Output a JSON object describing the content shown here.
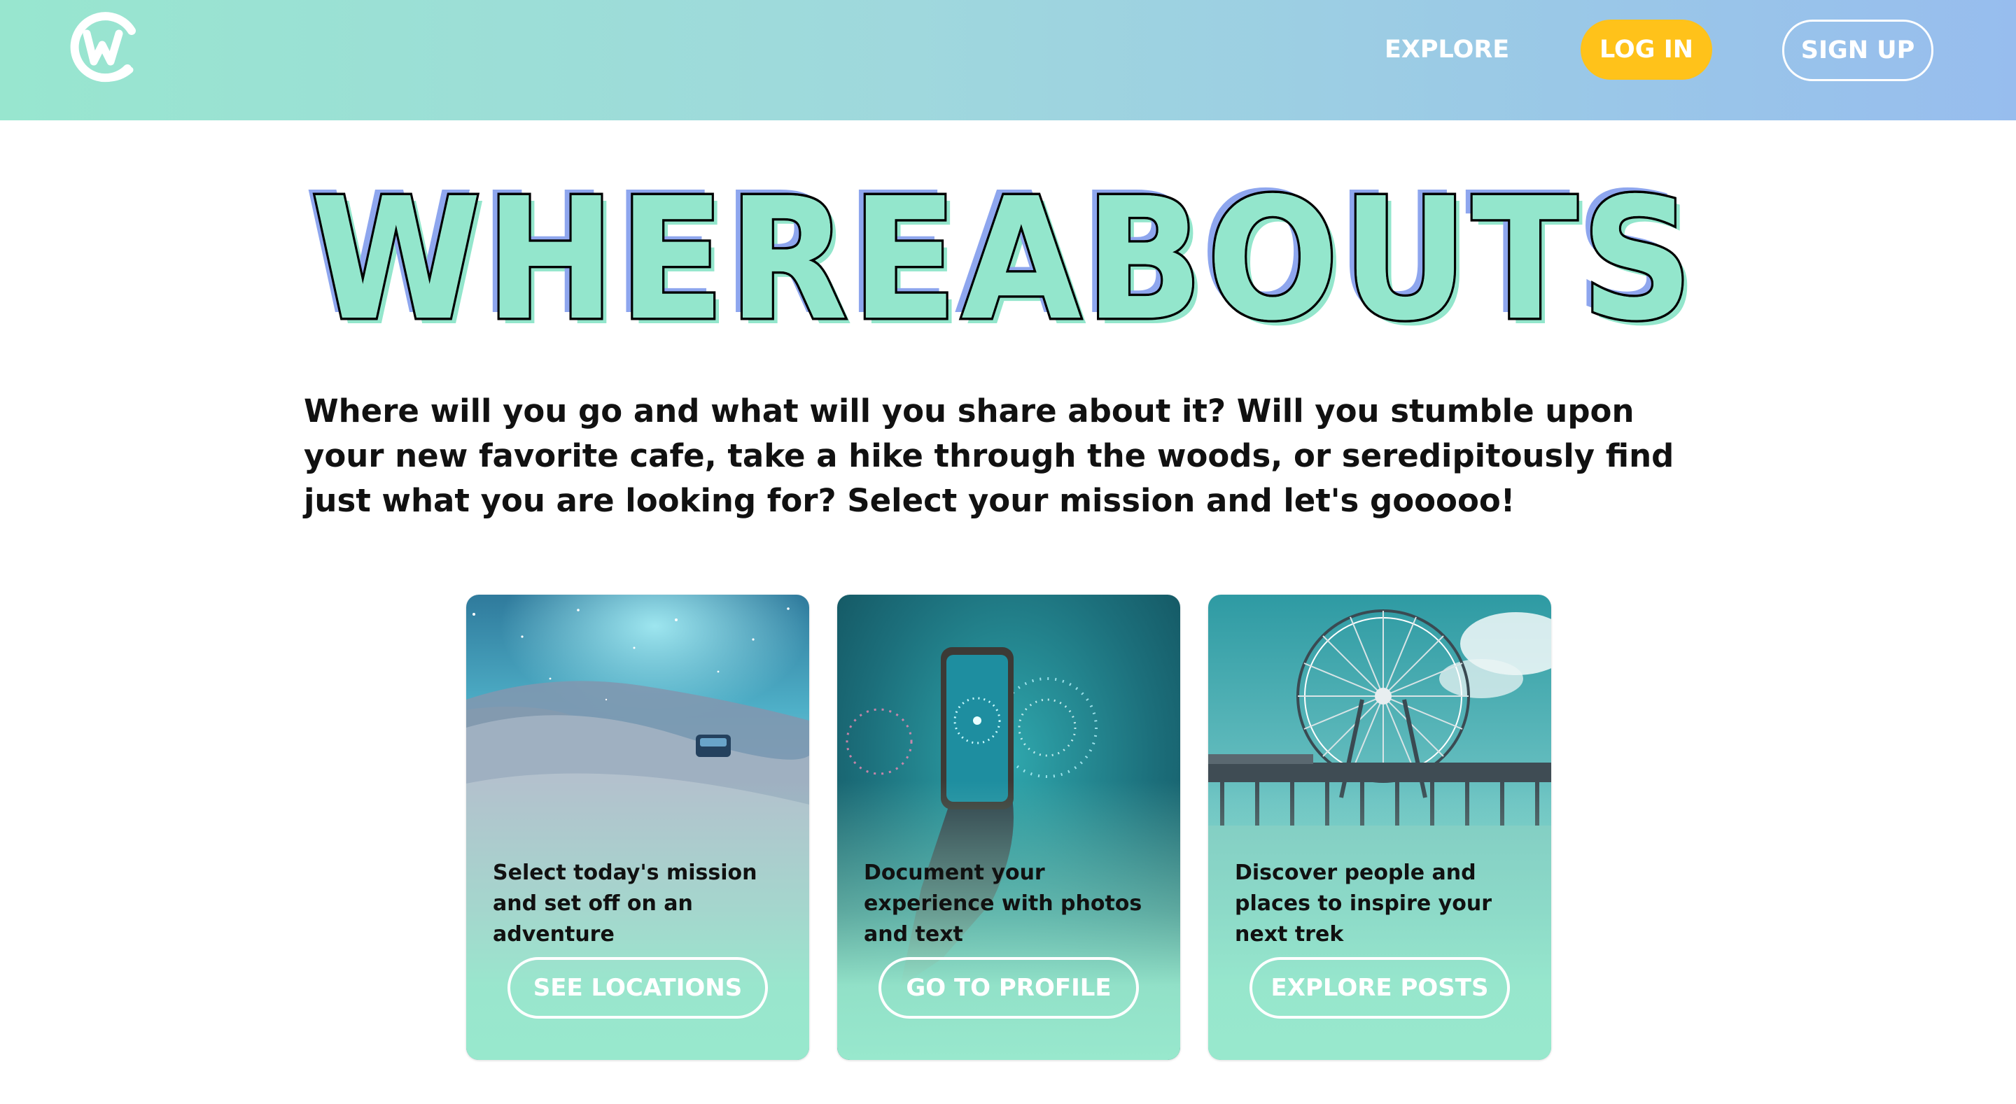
{
  "header": {
    "logo_icon": "whereabouts-w-logo-icon",
    "nav": {
      "explore_label": "EXPLORE",
      "login_label": "LOG IN",
      "signup_label": "SIGN UP"
    }
  },
  "hero": {
    "title": "WHEREABOUTS",
    "intro": "Where will you go and what will you share about it? Will you stumble upon your new favorite cafe, take a hike through the woods, or seredipitously find just what you are looking for? Select your mission and let's gooooo!"
  },
  "cards": [
    {
      "image": "night-sky-desert-car-image",
      "text": "Select today's mission and set off on an adventure",
      "button_label": "SEE LOCATIONS"
    },
    {
      "image": "phone-fireworks-image",
      "text": "Document your experience with photos and text",
      "button_label": "GO TO PROFILE"
    },
    {
      "image": "ferris-wheel-pier-image",
      "text": "Discover people and places to inspire your next trek",
      "button_label": "EXPLORE POSTS"
    }
  ],
  "colors": {
    "header_left": "#98e6cf",
    "header_right": "#97bdee",
    "accent_yellow": "#ffc21a",
    "mint": "#98e8cd",
    "title_shadow_blue": "#8ea6ee",
    "title_fill": "#93e6cc"
  }
}
